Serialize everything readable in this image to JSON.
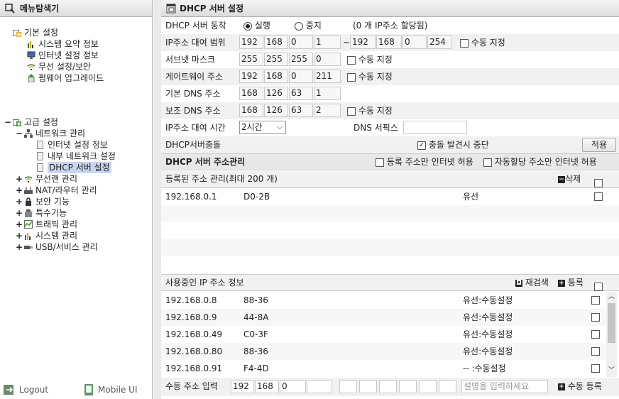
{
  "left": {
    "title": "메뉴탐색기",
    "basic": {
      "label": "기본 설정",
      "items": [
        "시스템 요약 정보",
        "인터넷 설정 정보",
        "무선 설정/보안",
        "펌웨어 업그레이드"
      ]
    },
    "advanced": {
      "label": "고급 설정",
      "network": {
        "label": "네트워크 관리",
        "items": [
          "인터넷 설정 정보",
          "내부 네트워크 설정",
          "DHCP 서버 설정"
        ]
      },
      "others": [
        "무선랜 관리",
        "NAT/라우터 관리",
        "보안 기능",
        "특수기능",
        "트래픽 관리",
        "시스템 관리",
        "USB/서비스 관리"
      ]
    },
    "footer": {
      "logout": "Logout",
      "mobile": "Mobile UI"
    }
  },
  "main": {
    "title": "DHCP 서버 설정",
    "status": {
      "label": "DHCP 서버 동작",
      "run": "실행",
      "stop": "중지",
      "info": "(0 개 IP주소 할당됨)"
    },
    "range": {
      "label": "IP주소 대여 범위",
      "start": [
        "192",
        "168",
        "0",
        "1"
      ],
      "end": [
        "192",
        "168",
        "0",
        "254"
      ],
      "tilde": "~",
      "manual": "수동 지정"
    },
    "subnet": {
      "label": "서브넷 마스크",
      "value": [
        "255",
        "255",
        "255",
        "0"
      ],
      "manual": "수동 지정"
    },
    "gateway": {
      "label": "게이트웨이 주소",
      "value": [
        "192",
        "168",
        "0",
        "211"
      ],
      "manual": "수동 지정"
    },
    "dns1": {
      "label": "기본 DNS 주소",
      "value": [
        "168",
        "126",
        "63",
        "1"
      ]
    },
    "dns2": {
      "label": "보조 DNS 주소",
      "value": [
        "168",
        "126",
        "63",
        "2"
      ],
      "manual": "수동 지정"
    },
    "lease": {
      "label": "IP주소 대여 시간",
      "value": "2시간",
      "dns_suffix_label": "DNS 서픽스",
      "dns_suffix": ""
    },
    "conflict": {
      "label": "DHCP서버충돌",
      "option": "충돌 발견시 중단",
      "apply": "적용"
    },
    "mgmt": {
      "title": "DHCP 서버 주소관리",
      "opt1": "등록 주소만 인터넷 허용",
      "opt2": "자동할당 주소만 인터넷 허용"
    },
    "registered": {
      "title": "등록된 주소 관리(최대 200 개)",
      "delete": "삭제",
      "rows": [
        {
          "ip": "192.168.0.1",
          "mac": "D0-2B",
          "type": "유선"
        }
      ]
    },
    "inuse": {
      "title": "사용중인 IP 주소 정보",
      "rescan": "재검색",
      "register": "등록",
      "rows": [
        {
          "ip": "192.168.0.8",
          "mac": "88-36",
          "type": "유선:수동설정"
        },
        {
          "ip": "192.168.0.9",
          "mac": "44-8A",
          "type": "유선:수동설정"
        },
        {
          "ip": "192.168.0.49",
          "mac": "C0-3F",
          "type": "유선:수동설정"
        },
        {
          "ip": "192.168.0.80",
          "mac": "88-36",
          "type": "유선:수동설정"
        },
        {
          "ip": "192.168.0.91",
          "mac": "F4-4D",
          "type": "-- :수동설정"
        }
      ]
    },
    "manual": {
      "label": "수동 주소 입력",
      "ip": [
        "192",
        "168",
        "0",
        ""
      ],
      "desc_placeholder": "설명을 입력하세요",
      "button": "수동 등록"
    }
  }
}
